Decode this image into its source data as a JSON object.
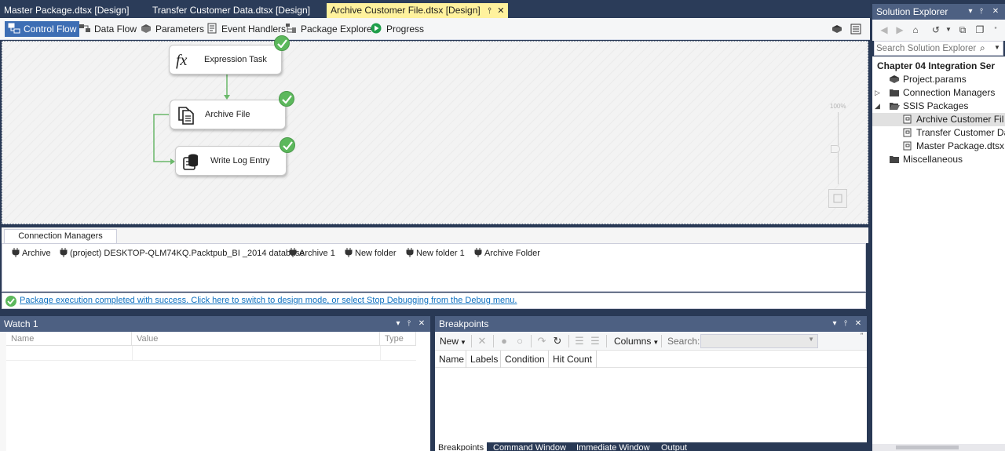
{
  "document_tabs": [
    {
      "label": "Master Package.dtsx [Design]",
      "active": false
    },
    {
      "label": "Transfer Customer Data.dtsx [Design]",
      "active": false
    },
    {
      "label": "Archive Customer File.dtsx [Design]",
      "active": true
    }
  ],
  "designer_tabs": [
    {
      "label": "Control Flow",
      "active": true
    },
    {
      "label": "Data Flow",
      "active": false
    },
    {
      "label": "Parameters",
      "active": false
    },
    {
      "label": "Event Handlers",
      "active": false
    },
    {
      "label": "Package Explorer",
      "active": false
    },
    {
      "label": "Progress",
      "active": false
    }
  ],
  "tasks": [
    {
      "label": "Expression Task",
      "icon": "fx-icon",
      "status": "success"
    },
    {
      "label": "Archive File",
      "icon": "file-system-task-icon",
      "status": "success"
    },
    {
      "label": "Write Log Entry",
      "icon": "sql-task-icon",
      "status": "success"
    }
  ],
  "zoom": {
    "label": "100%"
  },
  "connection_managers": {
    "tab_label": "Connection Managers",
    "items": [
      "Archive",
      "(project) DESKTOP-QLM74KQ.Packtpub_BI _2014 database",
      "Archive 1",
      "New folder",
      "New folder 1",
      "Archive Folder"
    ]
  },
  "status": {
    "message": "Package execution completed with success. Click here to switch to design mode, or select Stop Debugging from the Debug menu."
  },
  "watch": {
    "title": "Watch 1",
    "columns": [
      "Name",
      "Value",
      "Type"
    ]
  },
  "breakpoints": {
    "title": "Breakpoints",
    "new_label": "New",
    "columns_label": "Columns",
    "search_label": "Search:",
    "columns": [
      "Name",
      "Labels",
      "Condition",
      "Hit Count"
    ]
  },
  "bottom_tabs": [
    {
      "label": "Breakpoints",
      "active": true
    },
    {
      "label": "Command Window",
      "active": false
    },
    {
      "label": "Immediate Window",
      "active": false
    },
    {
      "label": "Output",
      "active": false
    }
  ],
  "solution_explorer": {
    "title": "Solution Explorer",
    "search_placeholder": "Search Solution Explorer (",
    "project": "Chapter 04 Integration Ser",
    "nodes": [
      {
        "label": "Project.params",
        "level": 1,
        "icon": "params-icon"
      },
      {
        "label": "Connection Managers",
        "level": 1,
        "icon": "folder-icon",
        "expand": "collapsed"
      },
      {
        "label": "SSIS Packages",
        "level": 1,
        "icon": "folder-icon",
        "expand": "expanded"
      },
      {
        "label": "Archive Customer Fil",
        "level": 2,
        "icon": "package-icon",
        "selected": true
      },
      {
        "label": "Transfer Customer Da",
        "level": 2,
        "icon": "package-icon"
      },
      {
        "label": "Master Package.dtsx",
        "level": 2,
        "icon": "package-icon"
      },
      {
        "label": "Miscellaneous",
        "level": 1,
        "icon": "folder-icon"
      }
    ]
  },
  "colors": {
    "ide_chrome": "#293955",
    "active_tab": "#fff29d",
    "tool_header": "#4d6082",
    "success": "#5cb85c",
    "connector": "#5cb85c",
    "link": "#0e70c0"
  }
}
